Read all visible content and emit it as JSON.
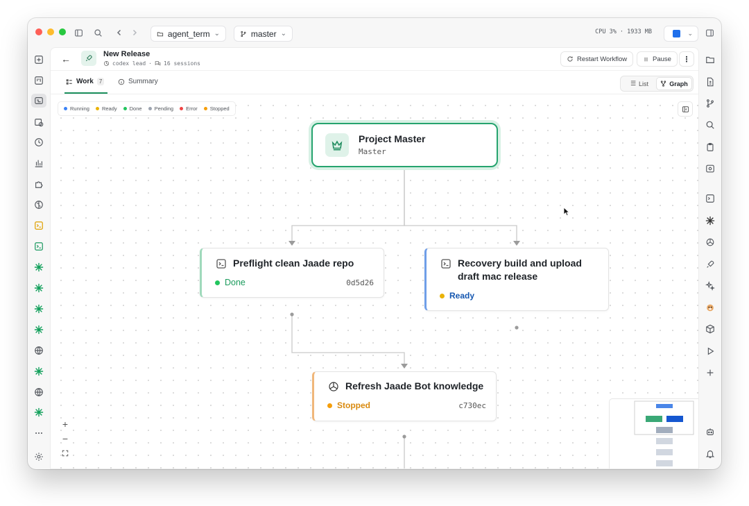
{
  "titlebar": {
    "folder": "agent_term",
    "branch": "master",
    "stats": "CPU 3% · 1933 MB",
    "accent": "#1f6feb"
  },
  "header": {
    "title": "New Release",
    "agent": "codex lead",
    "sessions": "16 sessions",
    "restart_label": "Restart Workflow",
    "pause_label": "Pause"
  },
  "tabs": {
    "work_label": "Work",
    "work_count": "7",
    "summary_label": "Summary",
    "list_label": "List",
    "graph_label": "Graph"
  },
  "legend": [
    {
      "label": "Running",
      "color": "#3b82f6"
    },
    {
      "label": "Ready",
      "color": "#eab308"
    },
    {
      "label": "Done",
      "color": "#22c55e"
    },
    {
      "label": "Pending",
      "color": "#9ca3af"
    },
    {
      "label": "Error",
      "color": "#ef4444"
    },
    {
      "label": "Stopped",
      "color": "#f59e0b"
    }
  ],
  "nodes": {
    "master": {
      "title": "Project Master",
      "subtitle": "Master"
    },
    "preflight": {
      "title": "Preflight clean Jaade repo",
      "status": "Done",
      "hash": "0d5d26",
      "status_color": "#1a9b5c",
      "bar_color": "#9fd9bb"
    },
    "recovery": {
      "title_line1": "Recovery build and upload",
      "title_line2": "draft mac release",
      "status": "Ready",
      "status_color": "#1557b0",
      "bar_color": "#6f9ee8"
    },
    "refresh": {
      "title": "Refresh Jaade Bot knowledge",
      "status": "Stopped",
      "hash": "c730ec",
      "status_color": "#d98a0f",
      "bar_color": "#f0b77a"
    }
  }
}
